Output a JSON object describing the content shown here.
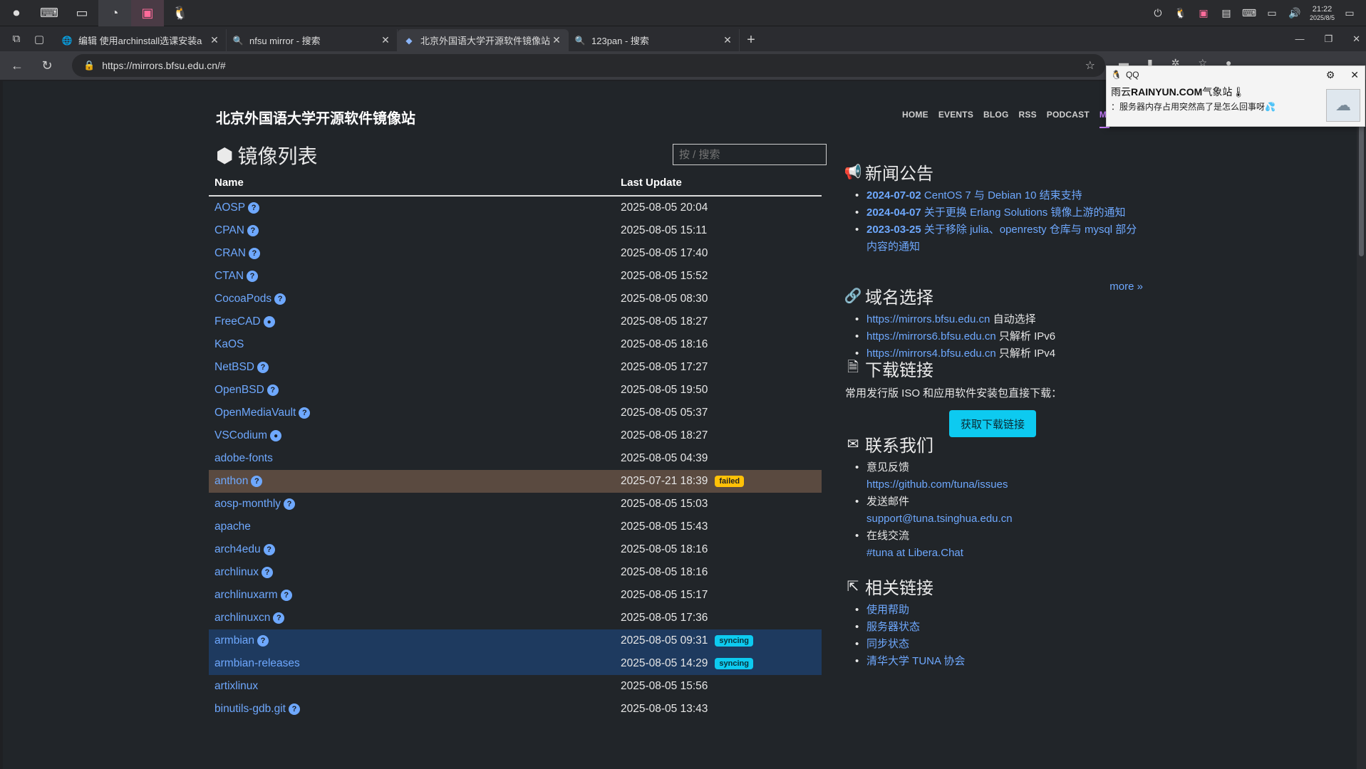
{
  "taskbar": {
    "apps": [
      "record-icon",
      "terminal-icon",
      "window-icon",
      "browser-icon",
      "bilibili-icon",
      "qq-icon"
    ],
    "time": "21:22",
    "date": "2025/8/5"
  },
  "tabs": [
    {
      "label": "编辑 使用archinstall选课安装a"
    },
    {
      "label": "nfsu mirror - 搜索"
    },
    {
      "label": "北京外国语大学开源软件镜像站"
    },
    {
      "label": "123pan - 搜索"
    }
  ],
  "address": {
    "url": "https://mirrors.bfsu.edu.cn/#"
  },
  "site": {
    "title": "北京外国语大学开源软件镜像站",
    "nav": [
      "HOME",
      "EVENTS",
      "BLOG",
      "RSS",
      "PODCAST",
      "MI"
    ]
  },
  "mirrors": {
    "heading": "镜像列表",
    "search_placeholder": "按 / 搜索",
    "col_name": "Name",
    "col_update": "Last Update",
    "rows": [
      {
        "name": "AOSP",
        "time": "2025-08-05 20:04",
        "icon": "help"
      },
      {
        "name": "CPAN",
        "time": "2025-08-05 15:11",
        "icon": "help"
      },
      {
        "name": "CRAN",
        "time": "2025-08-05 17:40",
        "icon": "help"
      },
      {
        "name": "CTAN",
        "time": "2025-08-05 15:52",
        "icon": "help"
      },
      {
        "name": "CocoaPods",
        "time": "2025-08-05 08:30",
        "icon": "help"
      },
      {
        "name": "FreeCAD",
        "time": "2025-08-05 18:27",
        "icon": "github"
      },
      {
        "name": "KaOS",
        "time": "2025-08-05 18:16",
        "icon": ""
      },
      {
        "name": "NetBSD",
        "time": "2025-08-05 17:27",
        "icon": "help"
      },
      {
        "name": "OpenBSD",
        "time": "2025-08-05 19:50",
        "icon": "help"
      },
      {
        "name": "OpenMediaVault",
        "time": "2025-08-05 05:37",
        "icon": "help"
      },
      {
        "name": "VSCodium",
        "time": "2025-08-05 18:27",
        "icon": "github"
      },
      {
        "name": "adobe-fonts",
        "time": "2025-08-05 04:39",
        "icon": ""
      },
      {
        "name": "anthon",
        "time": "2025-07-21 18:39",
        "icon": "help",
        "status": "failed"
      },
      {
        "name": "aosp-monthly",
        "time": "2025-08-05 15:03",
        "icon": "help"
      },
      {
        "name": "apache",
        "time": "2025-08-05 15:43",
        "icon": ""
      },
      {
        "name": "arch4edu",
        "time": "2025-08-05 18:16",
        "icon": "help"
      },
      {
        "name": "archlinux",
        "time": "2025-08-05 18:16",
        "icon": "help"
      },
      {
        "name": "archlinuxarm",
        "time": "2025-08-05 15:17",
        "icon": "help"
      },
      {
        "name": "archlinuxcn",
        "time": "2025-08-05 17:36",
        "icon": "help"
      },
      {
        "name": "armbian",
        "time": "2025-08-05 09:31",
        "icon": "help",
        "status": "syncing"
      },
      {
        "name": "armbian-releases",
        "time": "2025-08-05 14:29",
        "icon": "",
        "status": "syncing"
      },
      {
        "name": "artixlinux",
        "time": "2025-08-05 15:56",
        "icon": ""
      },
      {
        "name": "binutils-gdb.git",
        "time": "2025-08-05 13:43",
        "icon": "help"
      }
    ]
  },
  "news": {
    "title": "新闻公告",
    "items": [
      {
        "date": "2024-07-02",
        "text": " CentOS 7 与 Debian 10 结束支持"
      },
      {
        "date": "2024-04-07",
        "text": " 关于更换 Erlang Solutions 镜像上游的通知"
      },
      {
        "date": "2023-03-25",
        "text": " 关于移除 julia、openresty 仓库与 mysql 部分内容的通知"
      }
    ],
    "more": "more"
  },
  "domains": {
    "title": "域名选择",
    "items": [
      {
        "link": "https://mirrors.bfsu.edu.cn",
        "note": " 自动选择"
      },
      {
        "link": "https://mirrors6.bfsu.edu.cn",
        "note": " 只解析 IPv6"
      },
      {
        "link": "https://mirrors4.bfsu.edu.cn",
        "note": " 只解析 IPv4"
      }
    ]
  },
  "download": {
    "title": "下载链接",
    "desc": "常用发行版 ISO 和应用软件安装包直接下载：",
    "button": "获取下载链接"
  },
  "contact": {
    "title": "联系我们",
    "items": [
      {
        "label": "意见反馈",
        "link": "https://github.com/tuna/issues"
      },
      {
        "label": "发送邮件",
        "link": "support@tuna.tsinghua.edu.cn"
      },
      {
        "label": "在线交流",
        "link": "#tuna at Libera.Chat"
      }
    ]
  },
  "related": {
    "title": "相关链接",
    "items": [
      "使用帮助",
      "服务器状态",
      "同步状态",
      "清华大学 TUNA 协会"
    ]
  },
  "qq_popup": {
    "app": "QQ",
    "sender_prefix": "雨云",
    "sender_bold": "RAINYUN.COM",
    "sender_suffix": "气象站🌡",
    "message": "：服务器内存占用突然高了是怎么回事呀💦"
  },
  "colors": {
    "link": "#6ea8fe",
    "failed": "#ffc107",
    "syncing": "#0dcaf0",
    "accent": "#c77dff"
  }
}
